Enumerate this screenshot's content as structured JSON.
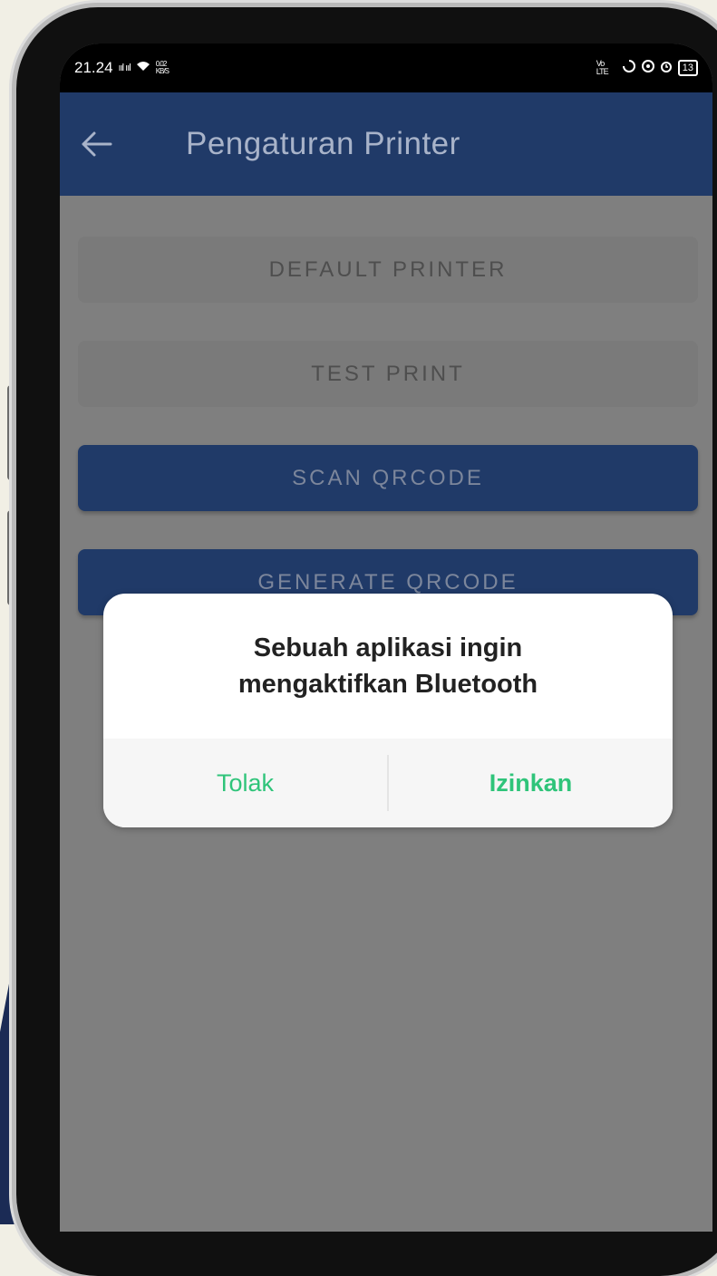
{
  "status_bar": {
    "time": "21.24",
    "signal_icons": "ııl ııl",
    "wifi_speed": "0.02 KB/S",
    "right_icons": "Vo LTE",
    "battery_level": "13"
  },
  "app_bar": {
    "title": "Pengaturan Printer",
    "back_icon": "arrow-left-icon"
  },
  "buttons": {
    "default_printer": "DEFAULT PRINTER",
    "test_print": "TEST PRINT",
    "scan_qrcode": "SCAN QRCODE",
    "generate_qrcode": "GENERATE QRCODE"
  },
  "dialog": {
    "message_line1": "Sebuah aplikasi ingin",
    "message_line2": "mengaktifkan Bluetooth",
    "deny_label": "Tolak",
    "allow_label": "Izinkan"
  },
  "colors": {
    "app_bar": "#203a68",
    "dialog_button": "#2fc47a",
    "scrim": "#7f7f7f"
  }
}
